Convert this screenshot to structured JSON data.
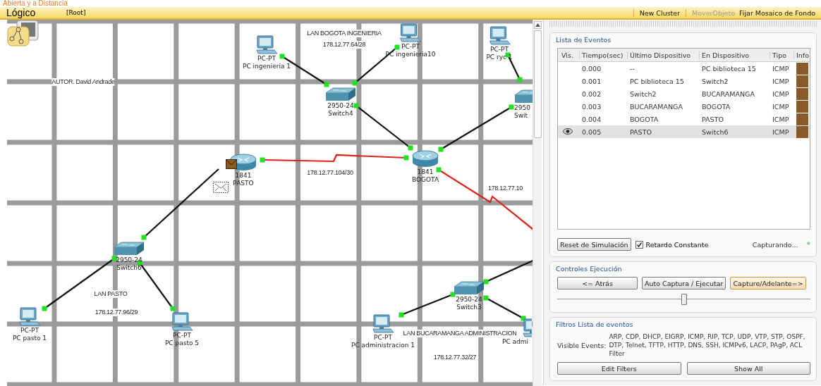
{
  "app_title": "Abierta y a  Distancia",
  "toolbar": {
    "mode": "Lógico",
    "path": "[Root]",
    "actions": [
      {
        "label": "New Cluster",
        "disabled": false
      },
      {
        "label": "MoverObjeto",
        "disabled": true
      },
      {
        "label": "Fijar Mosaico de Fondo",
        "disabled": false
      }
    ]
  },
  "canvas": {
    "devices": [
      {
        "kind": "pc",
        "model": "PC-PT",
        "name": "PC ingenieria 1"
      },
      {
        "kind": "pc",
        "model": "PC-PT",
        "name": "PC ingenieria10"
      },
      {
        "kind": "pc",
        "model": "PC-PT",
        "name": "PC ryc 1"
      },
      {
        "kind": "switch",
        "model": "2950-24",
        "name": "Switch4"
      },
      {
        "kind": "switch",
        "model": "2950",
        "name": "Swit"
      },
      {
        "kind": "router",
        "model": "1841",
        "name": "BOGOTA"
      },
      {
        "kind": "router",
        "model": "1841",
        "name": "PASTO"
      },
      {
        "kind": "switch",
        "model": "2950-24",
        "name": "Switch6"
      },
      {
        "kind": "pc",
        "model": "PC-PT",
        "name": "PC pasto 1"
      },
      {
        "kind": "pc",
        "model": "PC-PT",
        "name": "PC pasto 5"
      },
      {
        "kind": "pc",
        "model": "PC-PT",
        "name": "PC administracion 1"
      },
      {
        "kind": "switch",
        "model": "2950-24",
        "name": "Switch3"
      },
      {
        "kind": "pc",
        "name": "PC admi"
      }
    ],
    "links": [
      {
        "kind": "copper"
      },
      {
        "kind": "copper"
      },
      {
        "kind": "copper"
      },
      {
        "kind": "copper"
      },
      {
        "kind": "copper"
      },
      {
        "kind": "serial"
      },
      {
        "kind": "serial"
      },
      {
        "kind": "copper"
      },
      {
        "kind": "copper"
      },
      {
        "kind": "copper"
      },
      {
        "kind": "copper"
      },
      {
        "kind": "copper"
      },
      {
        "kind": "copper"
      }
    ],
    "notes": [
      "AUTOR. David Andrade",
      "LAN BOGOTA INGENIERIA",
      "178.12.77.64/28",
      "178.12.77.104/30",
      "178.12.77.10",
      "LAN PASTO",
      "178.12.77.96/29",
      "LAN BUCARAMANGA ADMINISTRACION",
      "178.12.77.32/27"
    ]
  },
  "event_list": {
    "title": "Lista de Eventos",
    "columns": [
      "Vis.",
      "Tiempo(sec)",
      "Último Dispositivo",
      "En Dispositivo",
      "Tipo",
      "Info"
    ],
    "rows": [
      {
        "time": "0.000",
        "last_device": "--",
        "at_device": "PC biblioteca 15",
        "type": "ICMP",
        "color": "#8b5a2b",
        "selected": false
      },
      {
        "time": "0.001",
        "last_device": "PC biblioteca 15",
        "at_device": "Switch2",
        "type": "ICMP",
        "color": "#8b5a2b",
        "selected": false
      },
      {
        "time": "0.002",
        "last_device": "Switch2",
        "at_device": "BUCARAMANGA",
        "type": "ICMP",
        "color": "#8b5a2b",
        "selected": false
      },
      {
        "time": "0.003",
        "last_device": "BUCARAMANGA",
        "at_device": "BOGOTA",
        "type": "ICMP",
        "color": "#8b5a2b",
        "selected": false
      },
      {
        "time": "0.004",
        "last_device": "BOGOTA",
        "at_device": "PASTO",
        "type": "ICMP",
        "color": "#8b5a2b",
        "selected": false
      },
      {
        "time": "0.005",
        "last_device": "PASTO",
        "at_device": "Switch6",
        "type": "ICMP",
        "color": "#8b5a2b",
        "selected": true
      }
    ],
    "reset_button": "Reset de Simulación",
    "constant_delay": {
      "label": "Retardo Constante",
      "checked": true
    },
    "status": "Capturando...",
    "status_mark": "*"
  },
  "controls": {
    "title": "Controles Ejecución",
    "buttons": [
      {
        "label": "<= Atrás",
        "focused": false
      },
      {
        "label": "Auto Captura / Ejecutar",
        "focused": false
      },
      {
        "label": "Capture/Adelante=>",
        "focused": true
      }
    ],
    "speed": {
      "level": 0.5
    }
  },
  "filters": {
    "title": "Filtros Lista de eventos",
    "label": "Visible Events:",
    "events": "ARP, CDP, DHCP, EIGRP, ICMP, RIP, TCP, UDP, VTP, STP, OSPF, DTP, Telnet, TFTP, HTTP, DNS, SSH, ICMPv6, LACP, PAgP, ACL Filter",
    "buttons": [
      "Edit Filters",
      "Show All"
    ]
  }
}
